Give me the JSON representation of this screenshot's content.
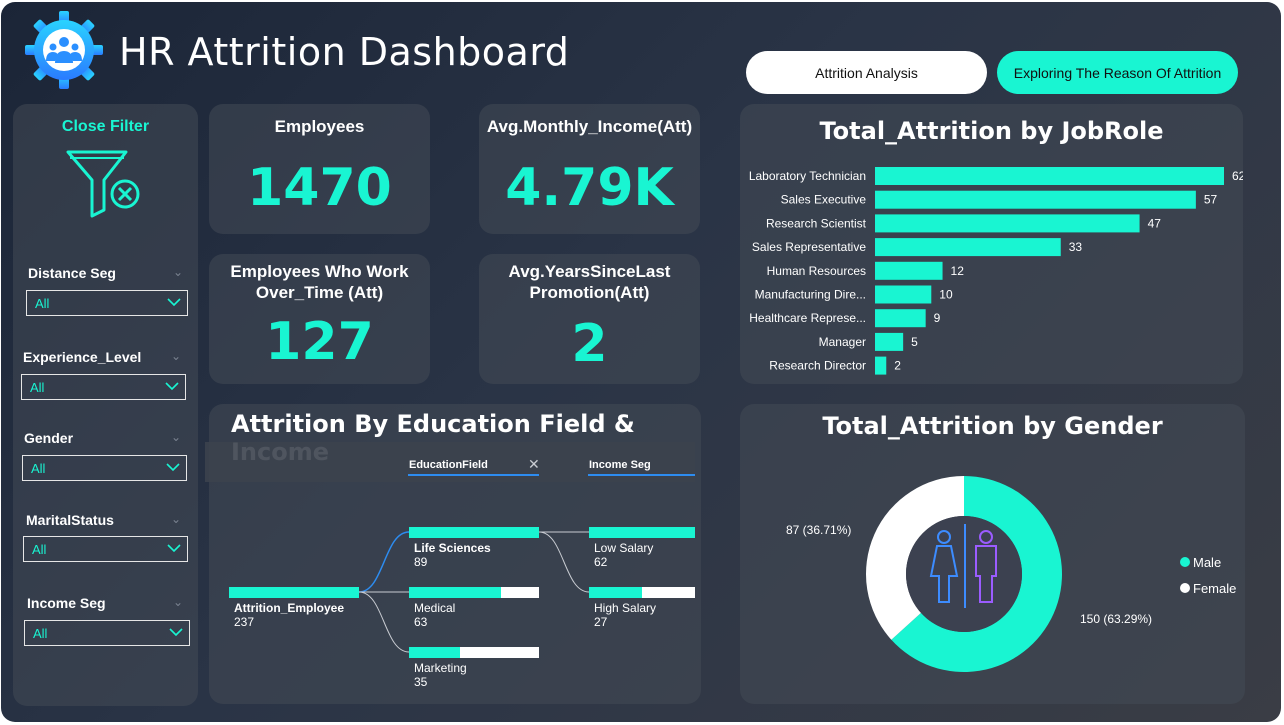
{
  "header": {
    "title": "HR Attrition Dashboard",
    "logo_icon": "gear-people-icon",
    "buttons": [
      {
        "label": "Attrition Analysis"
      },
      {
        "label": "Exploring The Reason Of Attrition"
      }
    ]
  },
  "filters": {
    "close_label": "Close Filter",
    "icon": "filter-close-icon",
    "slicers": [
      {
        "label": "Distance Seg",
        "value": "All"
      },
      {
        "label": "Experience_Level",
        "value": "All"
      },
      {
        "label": "Gender",
        "value": "All"
      },
      {
        "label": "MaritalStatus",
        "value": "All"
      },
      {
        "label": "Income Seg",
        "value": "All"
      }
    ]
  },
  "kpis": {
    "employees": {
      "title": "Employees",
      "value": "1470"
    },
    "income": {
      "title": "Avg.Monthly_Income(Att)",
      "value": "4.79K"
    },
    "overtime": {
      "title_line1": "Employees Who Work",
      "title_line2": "Over_Time (Att)",
      "value": "127"
    },
    "promotion": {
      "title_line1": "Avg.YearsSinceLast",
      "title_line2": "Promotion(Att)",
      "value": "2"
    }
  },
  "jobrole_chart": {
    "title": "Total_Attrition by JobRole"
  },
  "decomp_tree": {
    "title": "Attrition By Education Field & Income",
    "level1_header": "EducationField",
    "level2_header": "Income Seg",
    "root": {
      "name": "Attrition_Employee",
      "value": "237"
    },
    "level1": [
      {
        "name": "Life Sciences",
        "value": "89",
        "fill": 1.0
      },
      {
        "name": "Medical",
        "value": "63",
        "fill": 0.71
      },
      {
        "name": "Marketing",
        "value": "35",
        "fill": 0.39
      }
    ],
    "level2": [
      {
        "name": "Low Salary",
        "value": "62",
        "fill": 1.0
      },
      {
        "name": "High Salary",
        "value": "27",
        "fill": 0.5
      }
    ]
  },
  "gender_chart": {
    "title": "Total_Attrition by Gender",
    "icon": "male-female-icon"
  },
  "chart_data": [
    {
      "type": "bar",
      "orientation": "horizontal",
      "title": "Total_Attrition by JobRole",
      "categories": [
        "Laboratory Technician",
        "Sales Executive",
        "Research Scientist",
        "Sales Representative",
        "Human Resources",
        "Manufacturing Dire...",
        "Healthcare Represe...",
        "Manager",
        "Research Director"
      ],
      "values": [
        62,
        57,
        47,
        33,
        12,
        10,
        9,
        5,
        2
      ],
      "color": "#19f5d2"
    },
    {
      "type": "pie",
      "style": "donut",
      "title": "Total_Attrition by Gender",
      "categories": [
        "Male",
        "Female"
      ],
      "values": [
        150,
        87
      ],
      "labels": [
        "150 (63.29%)",
        "87 (36.71%)"
      ],
      "colors": [
        "#19f5d2",
        "#ffffff"
      ],
      "legend": "right"
    }
  ]
}
